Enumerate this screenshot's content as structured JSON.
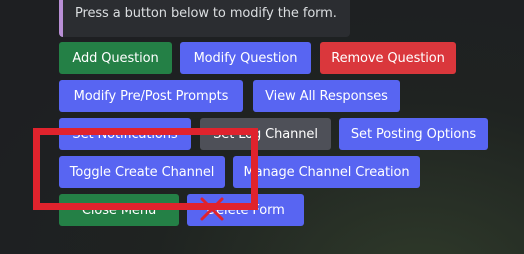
{
  "embed": {
    "text": "Press a button below to modify the form."
  },
  "buttons": {
    "add_question": "Add Question",
    "modify_question": "Modify Question",
    "remove_question": "Remove Question",
    "modify_prompts": "Modify Pre/Post Prompts",
    "view_all_responses": "View All Responses",
    "set_notifications": "Set Notifications",
    "set_log_channel": "Set Log Channel",
    "set_posting_options": "Set Posting Options",
    "toggle_create_channel": "Toggle Create Channel",
    "manage_channel_creation": "Manage Channel Creation",
    "close_menu": "Close Menu",
    "delete_form": "Delete Form"
  },
  "colors": {
    "blurple": "#5865f2",
    "green": "#248046",
    "red": "#da373c",
    "grey": "#4e5058",
    "annotation_red": "#e0232d"
  }
}
